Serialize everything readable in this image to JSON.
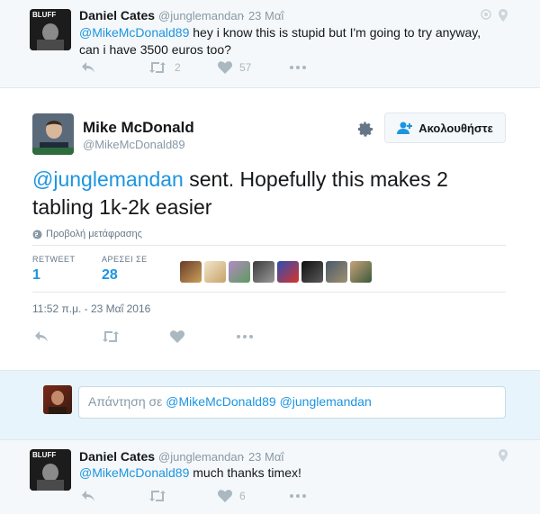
{
  "tweet1": {
    "name": "Daniel Cates",
    "handle": "@junglemandan",
    "time": "· 23 Μαΐ",
    "mention": "@MikeMcDonald89",
    "text": " hey i know this is stupid but I'm going to try anyway, can i have 3500 euros too?",
    "retweets": "2",
    "likes": "57"
  },
  "main": {
    "name": "Mike McDonald",
    "handle": "@MikeMcDonald89",
    "follow_label": "Ακολουθήστε",
    "mention": "@junglemandan",
    "text": " sent. Hopefully this makes 2 tabling 1k-2k easier",
    "translate_label": "Προβολή μετάφρασης",
    "retweet_label": "RETWEET",
    "retweet_count": "1",
    "likes_label": "ΑΡΕΣΕΙ ΣΕ",
    "likes_count": "28",
    "timestamp": "11:52 π.μ. - 23 Μαΐ 2016"
  },
  "reply": {
    "prefix": "Απάντηση σε ",
    "mention1": "@MikeMcDonald89",
    "mention2": "@junglemandan"
  },
  "tweet2": {
    "name": "Daniel Cates",
    "handle": "@junglemandan",
    "time": "· 23 Μαΐ",
    "mention": "@MikeMcDonald89",
    "text": " much thanks timex!",
    "likes": "6"
  },
  "colors": {
    "link": "#1b95e0",
    "muted": "#8899a6",
    "icon": "#aab8c2"
  }
}
